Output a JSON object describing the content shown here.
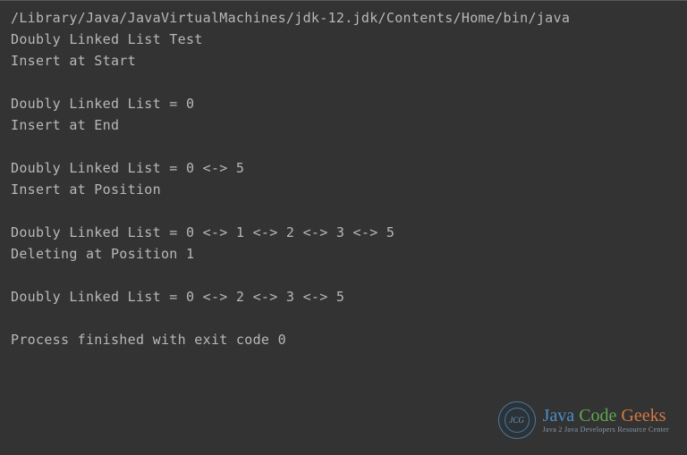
{
  "console": {
    "lines": [
      "/Library/Java/JavaVirtualMachines/jdk-12.jdk/Contents/Home/bin/java",
      "Doubly Linked List Test",
      "Insert at Start",
      "",
      "Doubly Linked List = 0",
      "Insert at End",
      "",
      "Doubly Linked List = 0 <-> 5",
      "Insert at Position",
      "",
      "Doubly Linked List = 0 <-> 1 <-> 2 <-> 3 <-> 5",
      "Deleting at Position 1",
      "",
      "Doubly Linked List = 0 <-> 2 <-> 3 <-> 5",
      "",
      "Process finished with exit code 0"
    ]
  },
  "watermark": {
    "logo_text": "JCG",
    "brand_java": "Java ",
    "brand_code": "Code ",
    "brand_geeks": "Geeks",
    "tagline": "Java 2 Java Developers Resource Center"
  }
}
